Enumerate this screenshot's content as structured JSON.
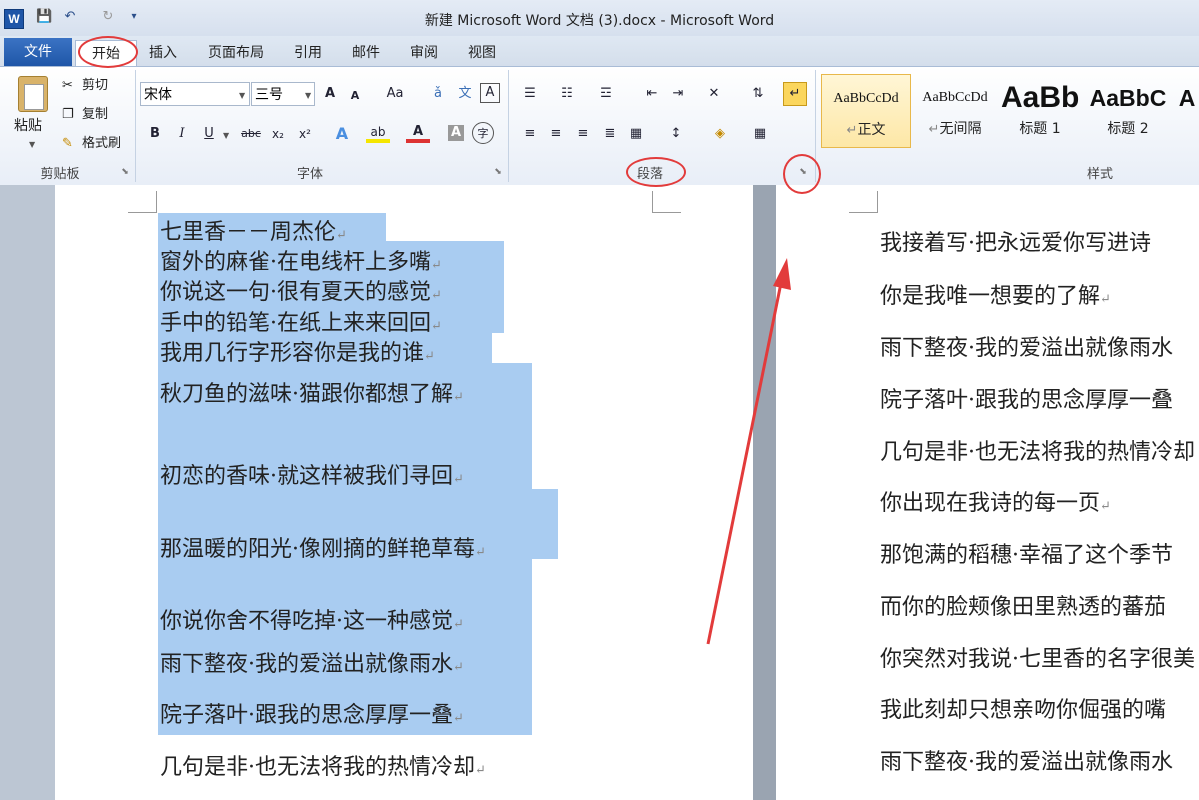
{
  "window": {
    "title": "新建 Microsoft Word 文档 (3).docx - Microsoft Word",
    "app_logo": "W"
  },
  "quick_access": {
    "save_icon": "💾",
    "undo_icon": "↶",
    "redo_icon": "↻",
    "customize_icon": "▾"
  },
  "tabs": [
    "文件",
    "开始",
    "插入",
    "页面布局",
    "引用",
    "邮件",
    "审阅",
    "视图"
  ],
  "clipboard": {
    "paste": "粘贴",
    "cut": "剪切",
    "copy": "复制",
    "format_painter": "格式刷",
    "label": "剪贴板"
  },
  "font": {
    "name": "宋体",
    "size": "三号",
    "label": "字体",
    "grow": "A",
    "shrink": "A",
    "case": "Aa",
    "clear": "A",
    "bold": "B",
    "italic": "I",
    "underline": "U",
    "strike": "abc",
    "sub": "x₂",
    "sup": "x²",
    "effects": "A",
    "highlight": "ab",
    "color": "A",
    "shade": "A",
    "enclose": "字"
  },
  "paragraph": {
    "label": "段落"
  },
  "styles": {
    "label": "样式",
    "items": [
      {
        "sample": "AaBbCcDd",
        "name": "正文"
      },
      {
        "sample": "AaBbCcDd",
        "name": "无间隔"
      },
      {
        "sample": "AaBb",
        "name": "标题 1"
      },
      {
        "sample": "AaBbC",
        "name": "标题 2"
      },
      {
        "sample": "A",
        "name": ""
      }
    ]
  },
  "page1": {
    "lines": [
      "七里香－－周杰伦",
      "窗外的麻雀·在电线杆上多嘴",
      "你说这一句·很有夏天的感觉",
      "手中的铅笔·在纸上来来回回",
      "我用几行字形容你是我的谁",
      "秋刀鱼的滋味·猫跟你都想了解",
      "初恋的香味·就这样被我们寻回",
      "那温暖的阳光·像刚摘的鲜艳草莓",
      "你说你舍不得吃掉·这一种感觉",
      "雨下整夜·我的爱溢出就像雨水",
      "院子落叶·跟我的思念厚厚一叠",
      "几句是非·也无法将我的热情冷却"
    ]
  },
  "page2": {
    "lines": [
      "我接着写·把永远爱你写进诗",
      "你是我唯一想要的了解",
      "雨下整夜·我的爱溢出就像雨水",
      "院子落叶·跟我的思念厚厚一叠",
      "几句是非·也无法将我的热情冷却",
      "你出现在我诗的每一页",
      "那饱满的稻穗·幸福了这个季节",
      "而你的脸颊像田里熟透的蕃茄",
      "你突然对我说·七里香的名字很美",
      "我此刻却只想亲吻你倔强的嘴",
      "雨下整夜·我的爱溢出就像雨水"
    ]
  },
  "colors": {
    "annotation": "#e23b3b",
    "selection": "#a9ccf1",
    "file_tab": "#1f56a8"
  }
}
